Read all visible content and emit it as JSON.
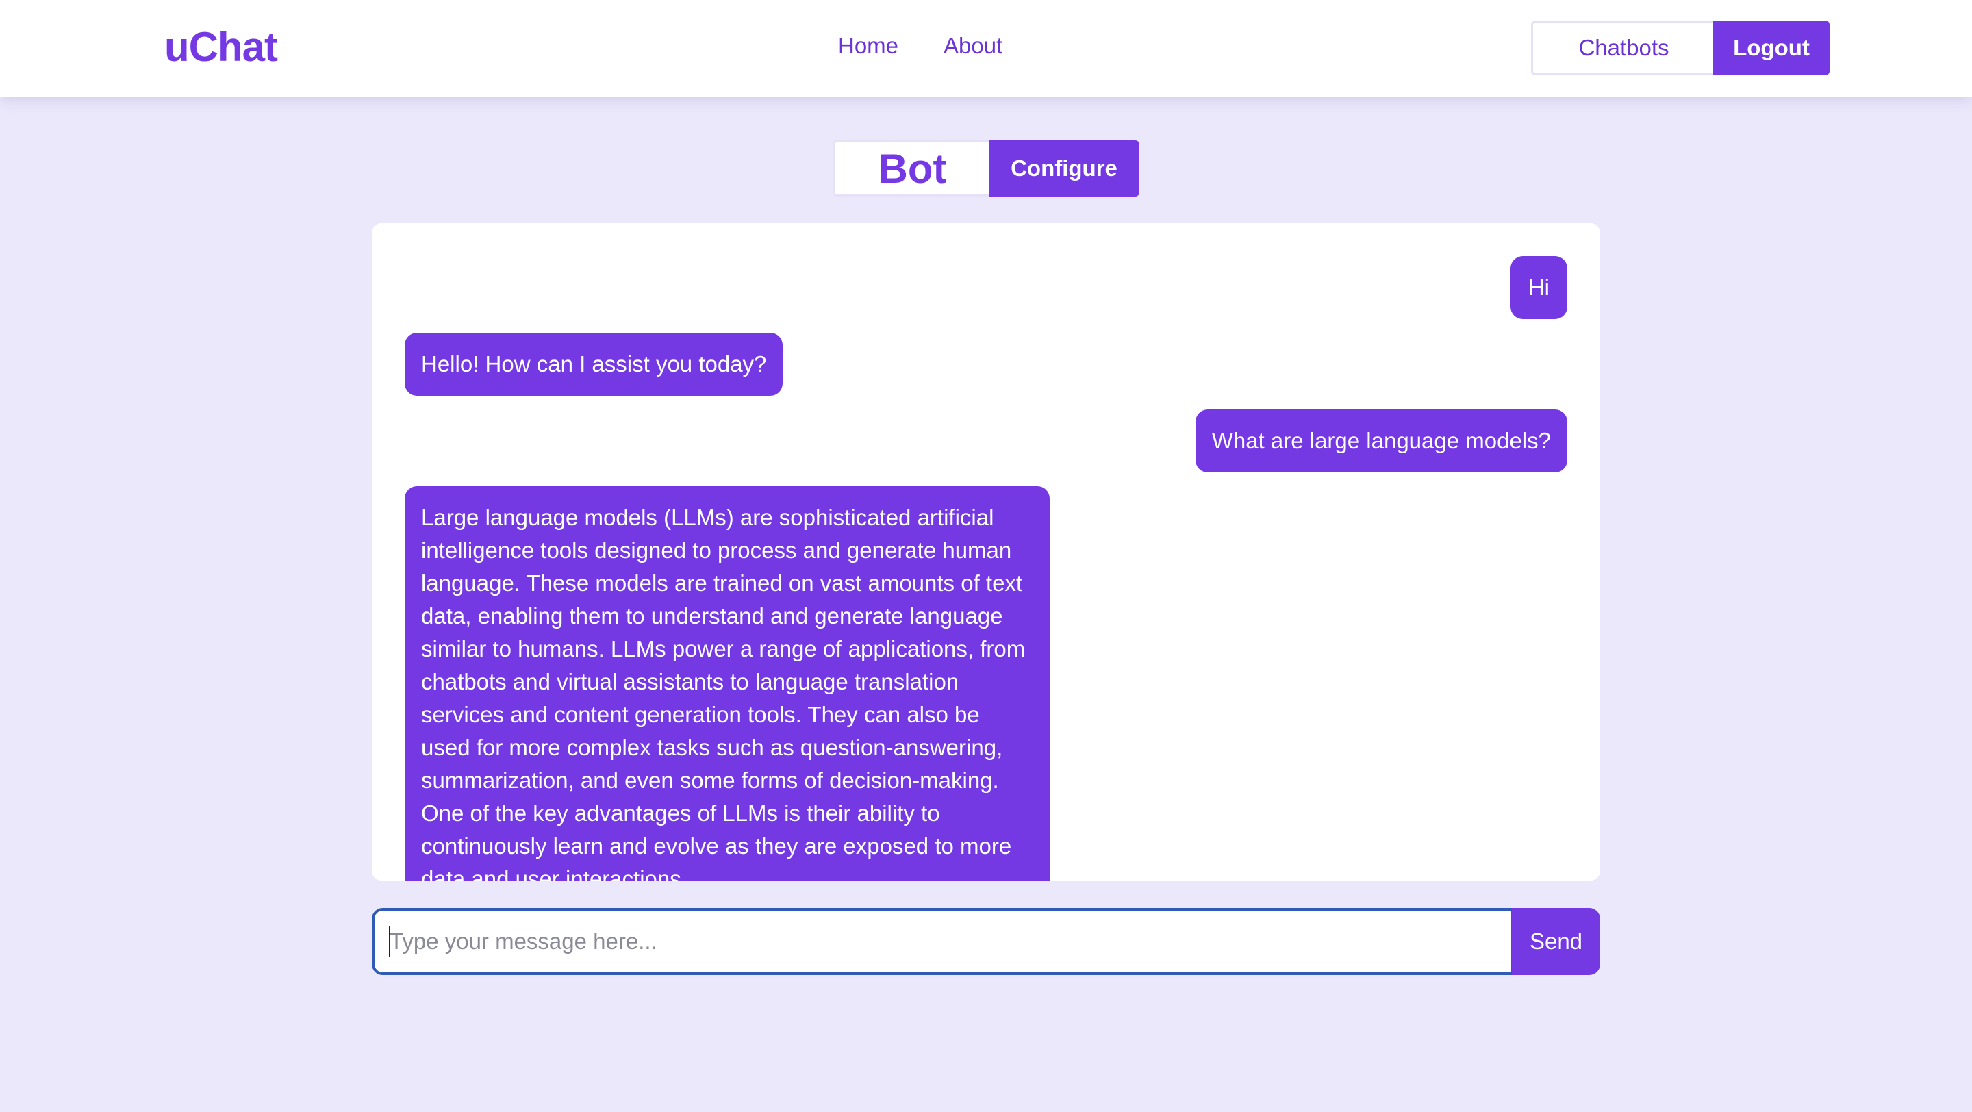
{
  "nav": {
    "logo": "uChat",
    "links": [
      {
        "label": "Home"
      },
      {
        "label": "About"
      }
    ],
    "chatbots_label": "Chatbots",
    "logout_label": "Logout"
  },
  "bot": {
    "name": "Bot",
    "configure_label": "Configure"
  },
  "messages": [
    {
      "role": "user",
      "text": "Hi"
    },
    {
      "role": "bot",
      "text": "Hello! How can I assist you today?"
    },
    {
      "role": "user",
      "text": "What are large language models?"
    },
    {
      "role": "bot",
      "text": "Large language models (LLMs) are sophisticated artificial intelligence tools designed to process and generate human language. These models are trained on vast amounts of text data, enabling them to understand and generate language similar to humans. LLMs power a range of applications, from chatbots and virtual assistants to language translation services and content generation tools. They can also be used for more complex tasks such as question-answering, summarization, and even some forms of decision-making. One of the key advantages of LLMs is their ability to continuously learn and evolve as they are exposed to more data and user interactions."
    }
  ],
  "composer": {
    "placeholder": "Type your message here...",
    "value": "",
    "send_label": "Send"
  },
  "colors": {
    "accent": "#7439e3",
    "background": "#ece8fb",
    "input_border": "#2f5bb7"
  }
}
